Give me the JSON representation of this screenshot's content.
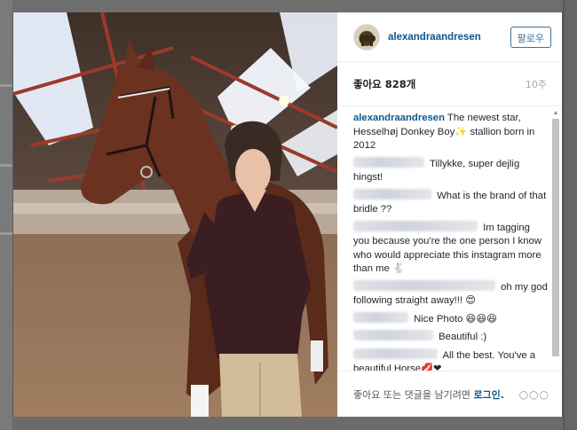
{
  "post": {
    "username": "alexandraandresen",
    "follow_label": "팔로우",
    "likes_text": "좋아요 828개",
    "time_ago": "10주"
  },
  "comments": [
    {
      "user": "alexandraandresen",
      "text": "The newest star, Hesselhøj Donkey Boy✨ stallion born in 2012",
      "blurred": false
    },
    {
      "text": "Tillykke, super dejlig hingst!",
      "blurred": true
    },
    {
      "text": "What is the brand of that bridle ??",
      "blurred": true
    },
    {
      "text": "Im tagging you because you're the one person I know who would appreciate this instagram more than me 🐇",
      "blurred": true
    },
    {
      "text": "oh my god following straight away!!! 😍",
      "blurred": true
    },
    {
      "text": "Nice Photo 😆😆😆",
      "blurred": true
    },
    {
      "text": "Beautiful :)",
      "blurred": true
    },
    {
      "text": "All the best. You've a beautiful Horse💋❤",
      "blurred": true
    },
    {
      "text": "🍀",
      "blurred": true
    },
    {
      "text": "👏👏😊",
      "blurred": true
    }
  ],
  "footer": {
    "prompt": "좋아요 또는 댓글을 남기려면",
    "login_label": "로그인.",
    "more_icon": "more-dots-icon"
  },
  "colors": {
    "link_blue": "#125688",
    "follow_blue": "#3f729b",
    "muted": "#a5a7aa"
  }
}
